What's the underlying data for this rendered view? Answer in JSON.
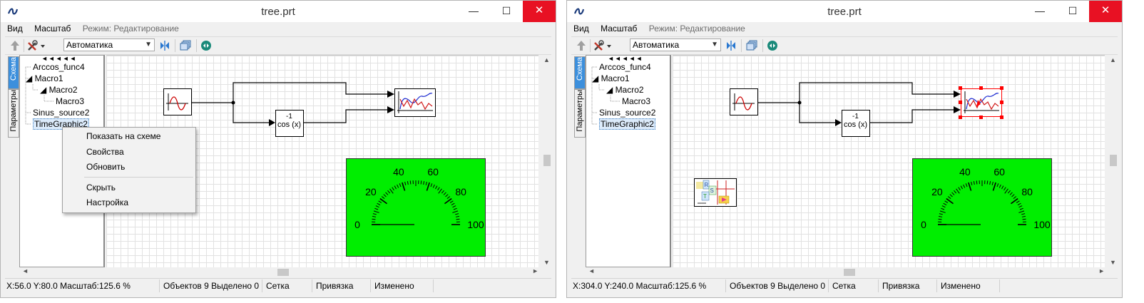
{
  "windows": [
    {
      "title": "tree.prt",
      "controls": {
        "minimize": "—",
        "maximize": "☐",
        "close": "✕"
      },
      "menu": {
        "view": "Вид",
        "scale": "Масштаб",
        "mode": "Режим: Редактирование"
      },
      "toolbar": {
        "combo_value": "Автоматика"
      },
      "side_tabs": {
        "schema": "Схема",
        "params": "Параметры"
      },
      "tree": {
        "nav_arrows": "◄◄◄◄◄",
        "items": [
          "Arccos_func4",
          "Macro1",
          "Macro2",
          "Macro3",
          "Sinus_source2",
          "TimeGraphic2"
        ]
      },
      "canvas": {
        "cos_label_exp": "-1",
        "cos_label": "cos (x)",
        "gauge_ticks": [
          "0",
          "20",
          "40",
          "60",
          "80",
          "100"
        ]
      },
      "context_menu": {
        "items": [
          "Показать на схеме",
          "Свойства",
          "Обновить",
          "Скрыть",
          "Настройка"
        ]
      },
      "status": {
        "coords": "X:56.0  Y:80.0  Масштаб:125.6 %",
        "objects": "Объектов 9  Выделено 0",
        "grid": "Сетка",
        "snap": "Привязка",
        "changed": "Изменено"
      }
    },
    {
      "title": "tree.prt",
      "controls": {
        "minimize": "—",
        "maximize": "☐",
        "close": "✕"
      },
      "menu": {
        "view": "Вид",
        "scale": "Масштаб",
        "mode": "Режим: Редактирование"
      },
      "toolbar": {
        "combo_value": "Автоматика"
      },
      "side_tabs": {
        "schema": "Схема",
        "params": "Параметры"
      },
      "tree": {
        "nav_arrows": "◄◄◄◄◄",
        "items": [
          "Arccos_func4",
          "Macro1",
          "Macro2",
          "Macro3",
          "Sinus_source2",
          "TimeGraphic2"
        ]
      },
      "canvas": {
        "cos_label_exp": "-1",
        "cos_label": "cos (x)",
        "gauge_ticks": [
          "0",
          "20",
          "40",
          "60",
          "80",
          "100"
        ]
      },
      "status": {
        "coords": "X:304.0  Y:240.0  Масштаб:125.6 %",
        "objects": "Объектов 9  Выделено 0",
        "grid": "Сетка",
        "snap": "Привязка",
        "changed": "Изменено"
      }
    }
  ],
  "colors": {
    "gauge": "#00ee00",
    "close_button": "#e81123",
    "selection": "#ff0000",
    "active_tab": "#3c8fdc"
  }
}
